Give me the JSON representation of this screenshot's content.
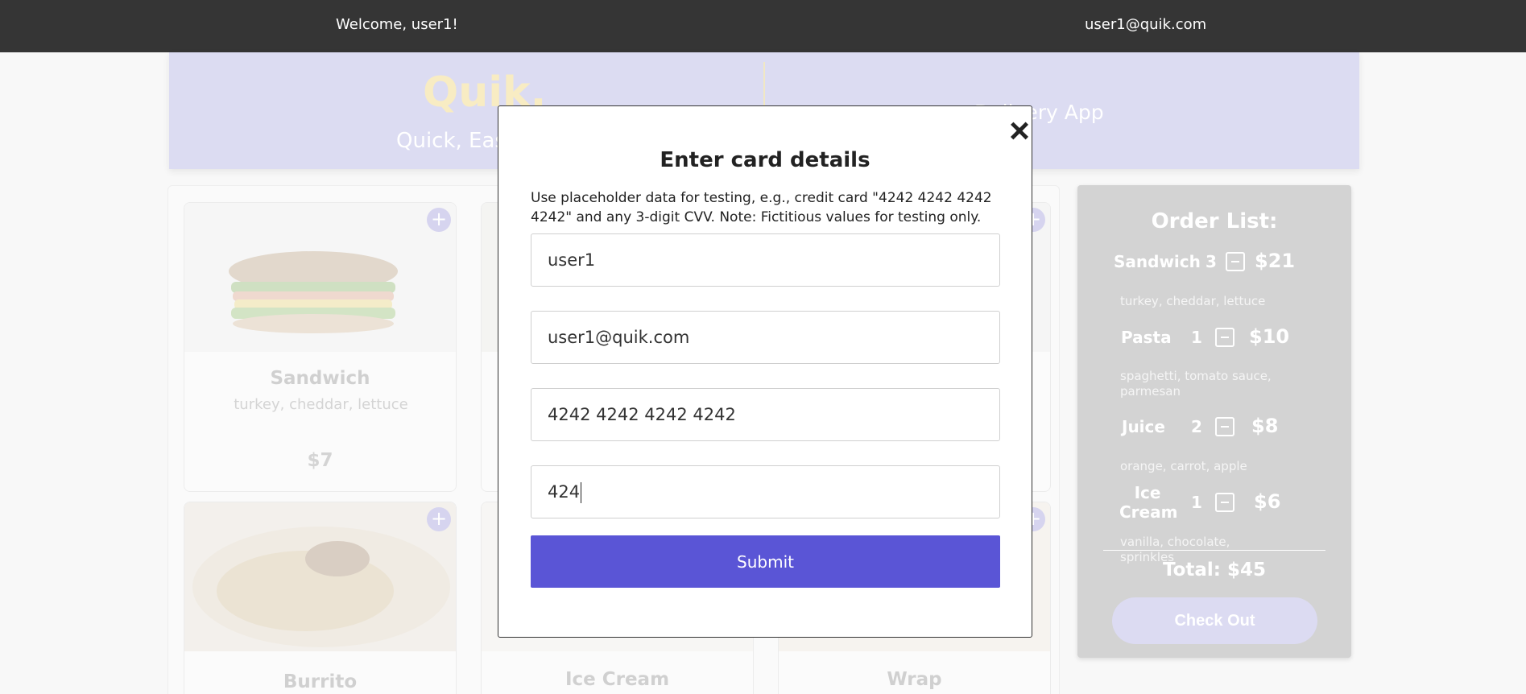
{
  "topbar": {
    "welcome": "Welcome, user1!",
    "email": "user1@quik.com"
  },
  "banner": {
    "logo": "Quik.",
    "tagline": "Quick, Eas",
    "subtitle": "Delivery App"
  },
  "menu": {
    "cards": [
      {
        "name": "Sandwich",
        "desc": "turkey, cheddar, lettuce",
        "price": "$7"
      },
      {
        "name": "Burrito"
      },
      {
        "name": "Ice Cream"
      },
      {
        "name": "Wrap"
      }
    ],
    "add_icon": "+"
  },
  "order": {
    "title": "Order List:",
    "items": [
      {
        "name": "Sandwich",
        "qty": "3",
        "price": "$21",
        "desc": "turkey, cheddar, lettuce"
      },
      {
        "name": "Pasta",
        "qty": "1",
        "price": "$10",
        "desc": "spaghetti, tomato sauce, parmesan"
      },
      {
        "name": "Juice",
        "qty": "2",
        "price": "$8",
        "desc": "orange, carrot, apple"
      },
      {
        "name": "Ice Cream",
        "qty": "1",
        "price": "$6",
        "desc": "vanilla, chocolate, sprinkles"
      }
    ],
    "total": "Total: $45",
    "checkout_label": "Check Out"
  },
  "modal": {
    "title": "Enter card details",
    "note": "Use placeholder data for testing, e.g., credit card \"4242 4242 4242 4242\" and any 3-digit CVV. Note: Fictitious values for testing only.",
    "name_value": "user1",
    "email_value": "user1@quik.com",
    "card_value": "4242 4242 4242 4242",
    "cvv_value": "424",
    "submit_label": "Submit",
    "close_icon": "×"
  },
  "colors": {
    "accent": "#5a55d6",
    "topbar": "#353535",
    "banner": "#dcdcf2"
  }
}
